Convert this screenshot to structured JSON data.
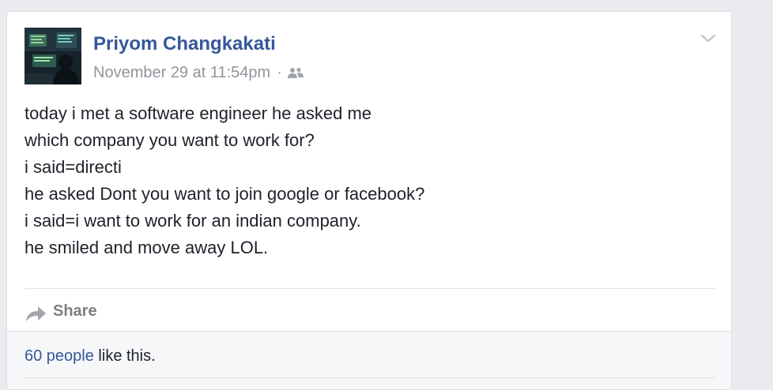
{
  "post": {
    "author": "Priyom Changkakati",
    "timestamp": "November 29 at 11:54pm",
    "separator": "·",
    "audience_icon": "friends-icon",
    "menu_icon": "chevron-down-icon",
    "body_lines": [
      "today i met a software engineer he asked me",
      "which company you want to work for?",
      "i said=directi",
      "he asked Dont you want to join google or facebook?",
      "i said=i want to work for an indian company.",
      "he smiled and move away LOL."
    ]
  },
  "actions": {
    "share_label": "Share",
    "share_icon": "share-arrow-icon"
  },
  "likes": {
    "count_text": "60 people",
    "suffix": " like this."
  },
  "colors": {
    "link_blue": "#365899",
    "meta_gray": "#90949c",
    "text": "#1d2129",
    "page_bg": "#e9ebee",
    "footer_bg": "#f6f7f9"
  }
}
